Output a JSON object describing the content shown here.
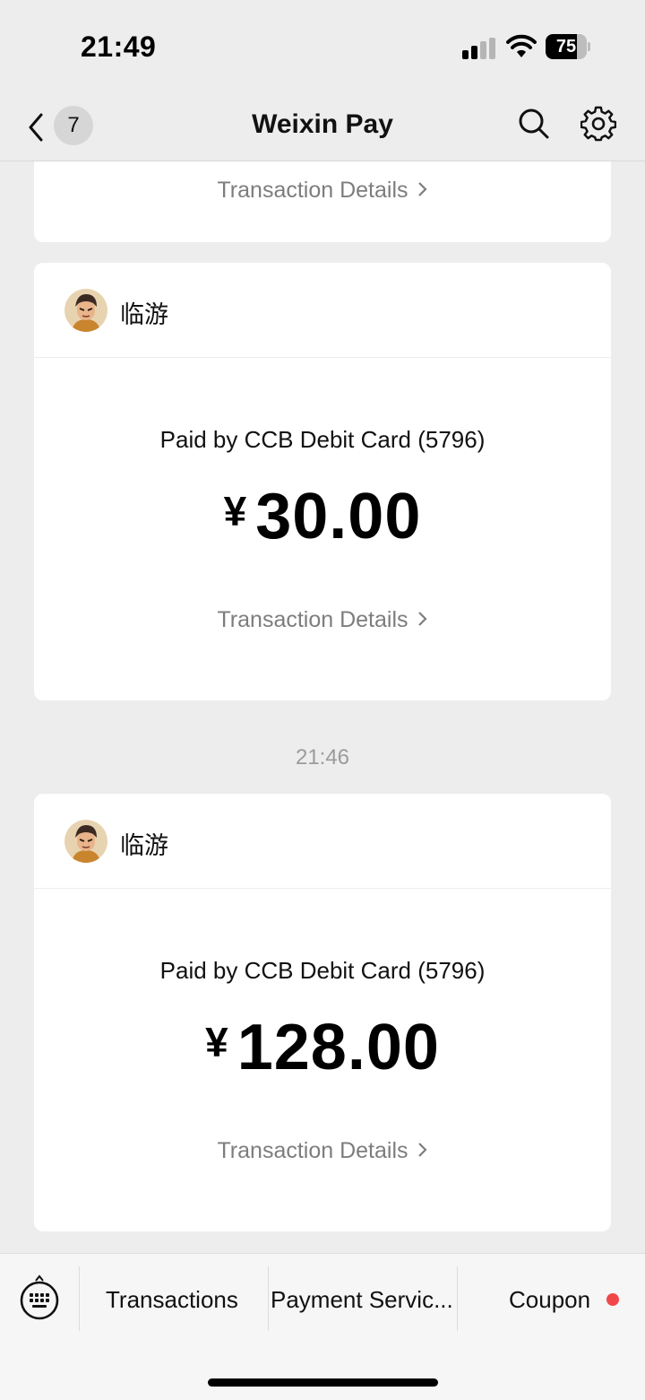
{
  "status_bar": {
    "time": "21:49",
    "battery_level": "75",
    "battery_fraction": 0.75
  },
  "nav": {
    "unread_count": "7",
    "title": "Weixin Pay",
    "icons": [
      "back-icon",
      "search-icon",
      "settings-icon"
    ]
  },
  "feed": {
    "partial_card": {
      "details_label": "Transaction Details"
    },
    "timestamp": "21:46",
    "cards": [
      {
        "merchant": "临游",
        "pay_method": "Paid by CCB Debit Card (5796)",
        "currency_symbol": "¥",
        "amount": "30.00",
        "details_label": "Transaction Details"
      },
      {
        "merchant": "临游",
        "pay_method": "Paid by CCB Debit Card (5796)",
        "currency_symbol": "¥",
        "amount": "128.00",
        "details_label": "Transaction Details"
      }
    ]
  },
  "bottom_menu": {
    "items": [
      {
        "label": "Transactions"
      },
      {
        "label": "Payment Servic..."
      },
      {
        "label": "Coupon"
      }
    ],
    "coupon_dot_color": "#f0484a"
  },
  "colors": {
    "background": "#ededed",
    "card": "#ffffff",
    "link_gray": "#7d7d7d",
    "timestamp_gray": "#9b9b9b"
  }
}
